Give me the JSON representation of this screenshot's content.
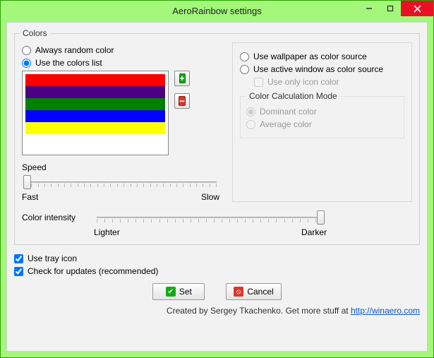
{
  "window": {
    "title": "AeroRainbow settings"
  },
  "group": {
    "colors": "Colors"
  },
  "left": {
    "opt_random": "Always random color",
    "opt_uselist": "Use the colors list",
    "colors": [
      "#ff0000",
      "#4b0082",
      "#008000",
      "#0000ff",
      "#ffff00"
    ],
    "speed_label": "Speed",
    "speed_fast": "Fast",
    "speed_slow": "Slow"
  },
  "right": {
    "opt_wallpaper": "Use wallpaper as color source",
    "opt_activewin": "Use active window as color source",
    "chk_icononly": "Use only icon color",
    "ccm_legend": "Color Calculation Mode",
    "ccm_dominant": "Dominant color",
    "ccm_average": "Average color"
  },
  "intensity": {
    "label": "Color intensity",
    "lighter": "Lighter",
    "darker": "Darker"
  },
  "checks": {
    "tray": "Use tray icon",
    "updates": "Check for updates (recommended)"
  },
  "buttons": {
    "set": "Set",
    "cancel": "Cancel"
  },
  "credits": {
    "text": "Created by Sergey Tkachenko. Get more stuff at  ",
    "link": "http://winaero.com"
  }
}
